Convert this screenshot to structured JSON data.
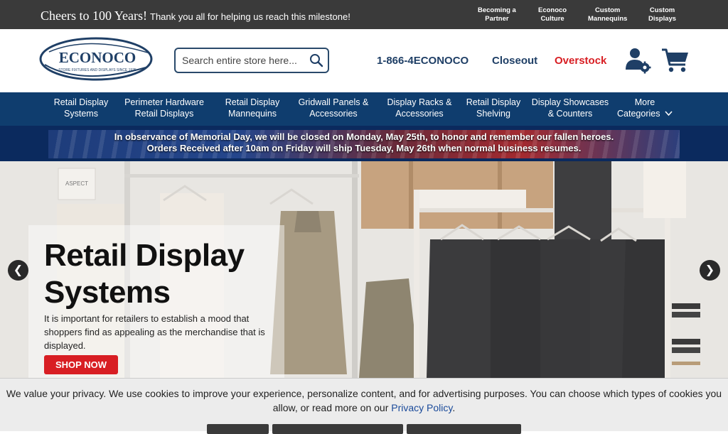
{
  "topbar": {
    "headline": "Cheers to 100 Years!",
    "subline": "Thank you all for helping us reach this milestone!",
    "links": [
      {
        "line1": "Becoming a",
        "line2": "Partner"
      },
      {
        "line1": "Econoco",
        "line2": "Culture"
      },
      {
        "line1": "Custom",
        "line2": "Mannequins"
      },
      {
        "line1": "Custom",
        "line2": "Displays"
      }
    ]
  },
  "header": {
    "logo_text": "ECONOCO",
    "logo_tagline": "STORE FIXTURES AND DISPLAYS SINCE 1925",
    "search_placeholder": "Search entire store here...",
    "phone": "1-866-4ECONOCO",
    "closeout": "Closeout",
    "overstock": "Overstock",
    "colors": {
      "navy": "#1f3f66",
      "red": "#d81e23"
    }
  },
  "nav": {
    "items": [
      {
        "line1": "Retail Display",
        "line2": "Systems"
      },
      {
        "line1": "Perimeter Hardware",
        "line2": "Retail Displays"
      },
      {
        "line1": "Retail Display",
        "line2": "Mannequins"
      },
      {
        "line1": "Gridwall Panels &",
        "line2": "Accessories"
      },
      {
        "line1": "Display Racks &",
        "line2": "Accessories"
      },
      {
        "line1": "Retail Display",
        "line2": "Shelving"
      },
      {
        "line1": "Display Showcases",
        "line2": "& Counters"
      },
      {
        "line1": "More",
        "line2": "Categories"
      }
    ]
  },
  "holiday": {
    "line1": "In observance of Memorial Day, we will be closed on Monday, May 25th, to honor and remember our fallen heroes.",
    "line2": "Orders Received after 10am on Friday will ship Tuesday, May 26th when normal business resumes."
  },
  "hero": {
    "title_line1": "Retail Display",
    "title_line2": "Systems",
    "description": "It is important for retailers to establish a mood that shoppers find as appealing as the merchandise that is displayed.",
    "cta": "SHOP NOW",
    "sign_text": "ASPECT"
  },
  "cookie": {
    "text_before": "We value your privacy. We use cookies to improve your experience, personalize content, and for advertising purposes. You can choose which types of cookies you allow, or read more on our",
    "link": "Privacy Policy",
    "text_after": "."
  }
}
